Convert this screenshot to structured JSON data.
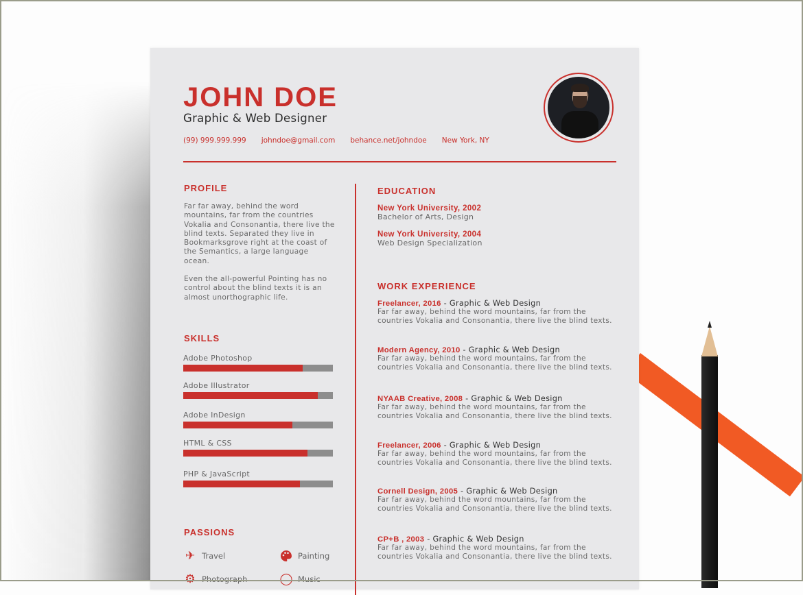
{
  "resume": {
    "name": "JOHN DOE",
    "title": "Graphic & Web Designer",
    "contacts": {
      "phone": "(99) 999.999.999",
      "email": "johndoe@gmail.com",
      "website": "behance.net/johndoe",
      "location": "New York, NY"
    },
    "accent_color": "#c9302c",
    "profile": {
      "heading": "PROFILE",
      "paragraphs": [
        "Far far away, behind the word mountains, far from the countries Vokalia and Consonantia, there live the blind texts. Separated they live in Bookmarksgrove right at the coast of the Semantics, a large language ocean.",
        "Even the all-powerful Pointing has no control about the blind texts it is an almost unorthographic life."
      ]
    },
    "skills": {
      "heading": "SKILLS",
      "items": [
        {
          "label": "Adobe Photoshop",
          "level": 0.8
        },
        {
          "label": "Adobe Illustrator",
          "level": 0.9
        },
        {
          "label": "Adobe InDesign",
          "level": 0.73
        },
        {
          "label": "HTML & CSS",
          "level": 0.83
        },
        {
          "label": "PHP & JavaScript",
          "level": 0.78
        }
      ]
    },
    "passions": {
      "heading": "PASSIONS",
      "items": [
        {
          "label": "Travel",
          "icon": "airplane-icon"
        },
        {
          "label": "Painting",
          "icon": "palette-icon"
        },
        {
          "label": "Photograph",
          "icon": "camera-icon"
        },
        {
          "label": "Music",
          "icon": "music-icon"
        }
      ]
    },
    "education": {
      "heading": "EDUCATION",
      "items": [
        {
          "school": "New York University, 2002",
          "degree": "Bachelor of Arts, Design"
        },
        {
          "school": "New York University, 2004",
          "degree": "Web Design Specialization"
        }
      ]
    },
    "work": {
      "heading": "WORK EXPERIENCE",
      "items": [
        {
          "company": "Freelancer, 2016",
          "role": " - Graphic & Web Design",
          "desc": "Far far away, behind the word mountains, far from the countries Vokalia and Consonantia, there live the blind texts."
        },
        {
          "company": "Modern Agency, 2010",
          "role": " - Graphic & Web Design",
          "desc": "Far far away, behind the word mountains, far from the countries Vokalia and Consonantia, there live the blind texts."
        },
        {
          "company": "NYAAB Creative, 2008",
          "role": " - Graphic & Web Design",
          "desc": "Far far away, behind the word mountains, far from the countries Vokalia and Consonantia, there live the blind texts."
        },
        {
          "company": "Freelancer, 2006",
          "role": " - Graphic & Web Design",
          "desc": "Far far away, behind the word mountains, far from the countries Vokalia and Consonantia, there live the blind texts."
        },
        {
          "company": "Cornell Design, 2005",
          "role": " - Graphic & Web Design",
          "desc": "Far far away, behind the word mountains, far from the countries Vokalia and Consonantia, there live the blind texts."
        },
        {
          "company": "CP+B , 2003",
          "role": " - Graphic & Web Design",
          "desc": "Far far away, behind the word mountains, far from the countries Vokalia and Consonantia, there live the blind texts."
        }
      ]
    }
  },
  "scene": {
    "stripe_color": "#f15a24",
    "pencil_color": "#1b1b1b"
  }
}
